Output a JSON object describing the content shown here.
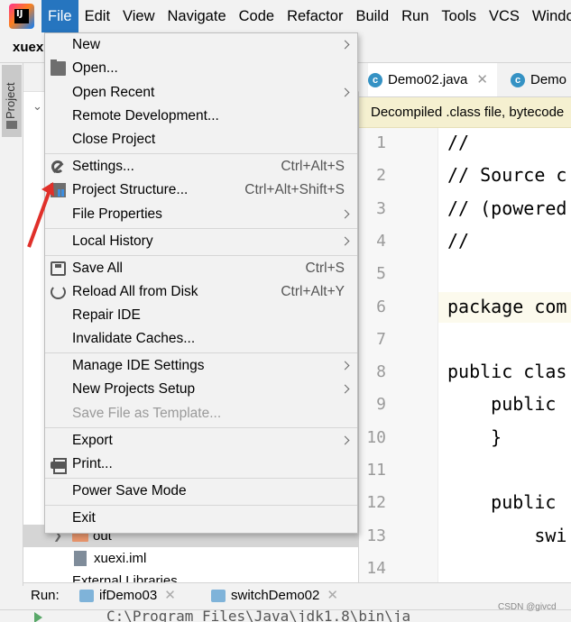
{
  "menubar": {
    "items": [
      {
        "label": "File",
        "mnemonic_index": 0,
        "active": true
      },
      {
        "label": "Edit",
        "mnemonic_index": 0
      },
      {
        "label": "View",
        "mnemonic_index": 0
      },
      {
        "label": "Navigate",
        "mnemonic_index": 0
      },
      {
        "label": "Code",
        "mnemonic_index": 0
      },
      {
        "label": "Refactor",
        "mnemonic_index": 0
      },
      {
        "label": "Build",
        "mnemonic_index": 0
      },
      {
        "label": "Run",
        "mnemonic_index": 0
      },
      {
        "label": "Tools",
        "mnemonic_index": 0
      },
      {
        "label": "VCS",
        "mnemonic_index": 0
      },
      {
        "label": "Windo",
        "mnemonic_index": 0
      }
    ],
    "accent": "#2675bf"
  },
  "navbar": {
    "project_crumb": "xuexi"
  },
  "project_panel": {
    "tab_label": "Project",
    "rows": [
      {
        "label": "out"
      },
      {
        "label": "xuexi.iml"
      },
      {
        "label": "External Libraries"
      }
    ]
  },
  "editor": {
    "tabs": [
      {
        "label": "Demo02.java",
        "icon": "class-icon"
      },
      {
        "label": "Demo",
        "icon": "class-icon"
      }
    ],
    "banner": "Decompiled .class file, bytecode",
    "lines": [
      {
        "n": "1",
        "code": "//"
      },
      {
        "n": "2",
        "code": "// Source c"
      },
      {
        "n": "3",
        "code": "// (powered"
      },
      {
        "n": "4",
        "code": "//"
      },
      {
        "n": "5",
        "code": ""
      },
      {
        "n": "6",
        "code": "package com"
      },
      {
        "n": "7",
        "code": ""
      },
      {
        "n": "8",
        "code": "public clas"
      },
      {
        "n": "9",
        "code": "    public "
      },
      {
        "n": "10",
        "code": "    }"
      },
      {
        "n": "11",
        "code": ""
      },
      {
        "n": "12",
        "code": "    public "
      },
      {
        "n": "13",
        "code": "        swi"
      },
      {
        "n": "14",
        "code": ""
      }
    ]
  },
  "file_menu": {
    "items": [
      {
        "label": "New",
        "submenu": true
      },
      {
        "label": "Open...",
        "icon": "folder-icon"
      },
      {
        "label": "Open Recent",
        "submenu": true
      },
      {
        "label": "Remote Development..."
      },
      {
        "label": "Close Project"
      },
      {
        "label": "Settings...",
        "shortcut": "Ctrl+Alt+S",
        "icon": "wrench-icon"
      },
      {
        "label": "Project Structure...",
        "shortcut": "Ctrl+Alt+Shift+S",
        "icon": "project-structure-icon"
      },
      {
        "label": "File Properties",
        "submenu": true
      },
      {
        "label": "Local History",
        "submenu": true
      },
      {
        "label": "Save All",
        "shortcut": "Ctrl+S",
        "icon": "save-icon"
      },
      {
        "label": "Reload All from Disk",
        "shortcut": "Ctrl+Alt+Y",
        "icon": "reload-icon"
      },
      {
        "label": "Repair IDE"
      },
      {
        "label": "Invalidate Caches..."
      },
      {
        "label": "Manage IDE Settings",
        "submenu": true
      },
      {
        "label": "New Projects Setup",
        "submenu": true
      },
      {
        "label": "Save File as Template...",
        "disabled": true
      },
      {
        "label": "Export",
        "submenu": true
      },
      {
        "label": "Print...",
        "icon": "print-icon"
      },
      {
        "label": "Power Save Mode"
      },
      {
        "label": "Exit"
      }
    ]
  },
  "runbar": {
    "label": "Run:",
    "tabs": [
      {
        "label": "ifDemo03"
      },
      {
        "label": "switchDemo02"
      }
    ]
  },
  "console": {
    "text": "C:\\Program Files\\Java\\jdk1.8\\bin\\ja"
  },
  "watermark": "CSDN @givcd",
  "annotation": {
    "color": "#e0302a"
  }
}
